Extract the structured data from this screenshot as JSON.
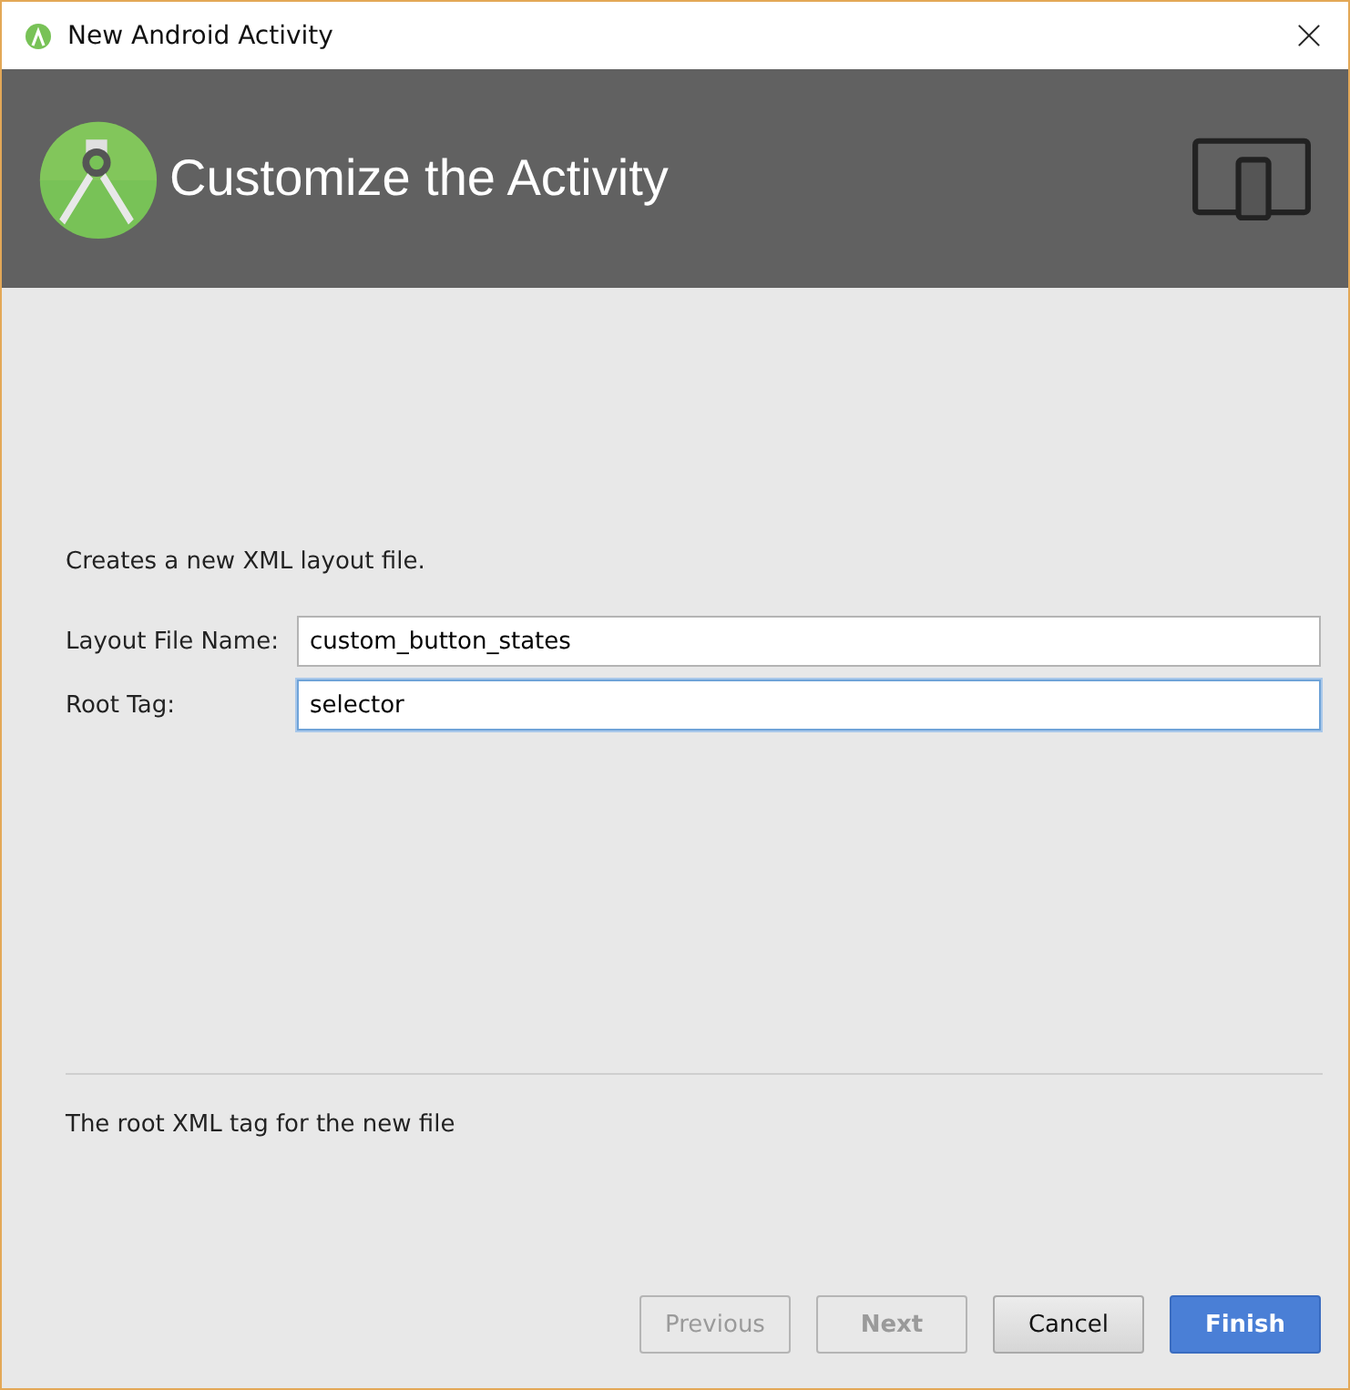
{
  "window": {
    "title": "New Android Activity"
  },
  "header": {
    "title": "Customize the Activity"
  },
  "description": "Creates a new XML layout file.",
  "fields": [
    {
      "label": "Layout File Name:",
      "value": "custom_button_states",
      "focused": false
    },
    {
      "label": "Root Tag:",
      "value": "selector",
      "focused": true
    }
  ],
  "hint": "The root XML tag for the new file",
  "buttons": [
    {
      "label": "Previous",
      "kind": "secondary",
      "disabled": true
    },
    {
      "label": "Next",
      "kind": "bold",
      "disabled": true
    },
    {
      "label": "Cancel",
      "kind": "secondary",
      "disabled": false
    },
    {
      "label": "Finish",
      "kind": "primary",
      "disabled": false
    }
  ]
}
